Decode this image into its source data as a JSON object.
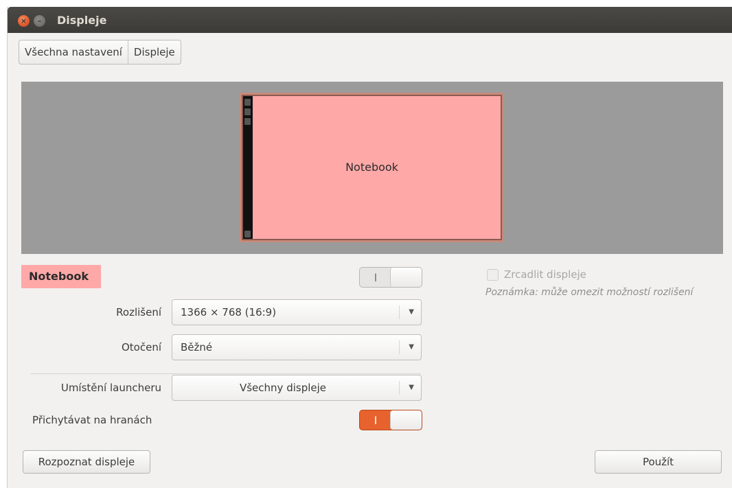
{
  "window": {
    "title": "Displeje",
    "close_glyph": "×",
    "minimize_glyph": "–"
  },
  "breadcrumb": {
    "items": [
      {
        "label": "Všechna nastavení"
      },
      {
        "label": "Displeje"
      }
    ]
  },
  "preview": {
    "monitor_label": "Notebook",
    "monitor_color": "#ffa8a8"
  },
  "display": {
    "name": "Notebook",
    "enabled_switch": {
      "on_glyph": "I",
      "state": "off"
    }
  },
  "mirror": {
    "label": "Zrcadlit displeje",
    "checked": false,
    "note": "Poznámka: může omezit možností rozlišení"
  },
  "settings": {
    "resolution": {
      "label": "Rozlišení",
      "value": "1366 × 768 (16:9)"
    },
    "rotation": {
      "label": "Otočení",
      "value": "Běžné"
    },
    "launcher_position": {
      "label": "Umístění launcheru",
      "value": "Všechny displeje"
    },
    "sticky_edges": {
      "label": "Přichytávat na hranách",
      "switch_glyph": "I",
      "state": "on"
    }
  },
  "buttons": {
    "detect": "Rozpoznat displeje",
    "apply": "Použít"
  },
  "icons": {
    "dropdown_arrow": "▼"
  },
  "colors": {
    "accent": "#e7622c",
    "titlebar": "#3c3b37",
    "preview_bg": "#9b9b9b"
  }
}
